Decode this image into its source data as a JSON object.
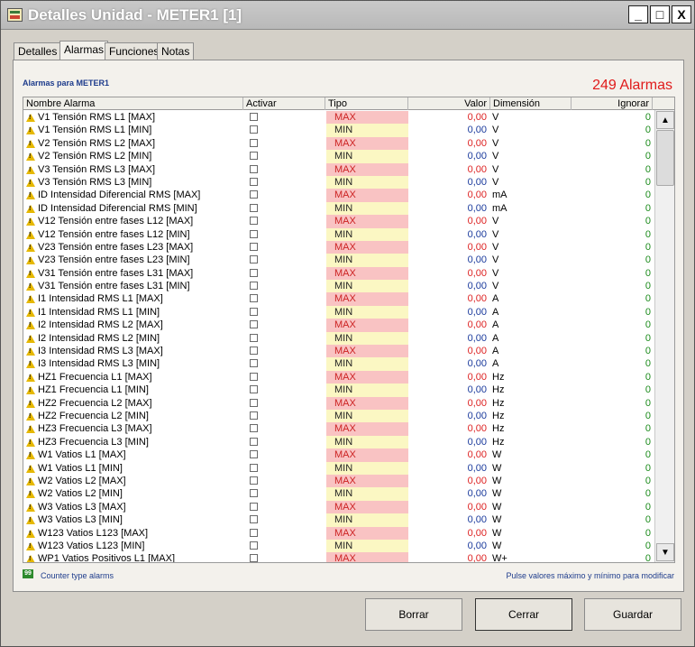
{
  "window": {
    "title": "Detalles Unidad - METER1 [1]",
    "buttons": {
      "minimize": "_",
      "maximize": "□",
      "close": "X"
    }
  },
  "tabs": [
    {
      "label": "Detalles",
      "active": false
    },
    {
      "label": "Alarmas",
      "active": true
    },
    {
      "label": "Funciones",
      "active": false
    },
    {
      "label": "Notas",
      "active": false
    }
  ],
  "panel": {
    "title": "Alarmas para METER1",
    "count": "249 Alarmas",
    "footer_badge": "99",
    "footer_left": "Counter type alarms",
    "footer_right": "Pulse valores máximo y mínimo para modificar"
  },
  "columns": {
    "name": "Nombre Alarma",
    "activar": "Activar",
    "tipo": "Tipo",
    "valor": "Valor",
    "dimension": "Dimensión",
    "ignorar": "Ignorar"
  },
  "rows": [
    {
      "name": "V1 Tensión RMS L1 [MAX]",
      "tipo": "MAX",
      "valor": "0,00",
      "dim": "V",
      "ign": "0"
    },
    {
      "name": "V1 Tensión RMS L1 [MIN]",
      "tipo": "MIN",
      "valor": "0,00",
      "dim": "V",
      "ign": "0"
    },
    {
      "name": "V2 Tensión RMS L2 [MAX]",
      "tipo": "MAX",
      "valor": "0,00",
      "dim": "V",
      "ign": "0"
    },
    {
      "name": "V2 Tensión RMS L2 [MIN]",
      "tipo": "MIN",
      "valor": "0,00",
      "dim": "V",
      "ign": "0"
    },
    {
      "name": "V3 Tensión RMS L3 [MAX]",
      "tipo": "MAX",
      "valor": "0,00",
      "dim": "V",
      "ign": "0"
    },
    {
      "name": "V3 Tensión RMS L3 [MIN]",
      "tipo": "MIN",
      "valor": "0,00",
      "dim": "V",
      "ign": "0"
    },
    {
      "name": "ID Intensidad Diferencial RMS [MAX]",
      "tipo": "MAX",
      "valor": "0,00",
      "dim": "mA",
      "ign": "0"
    },
    {
      "name": "ID Intensidad Diferencial RMS [MIN]",
      "tipo": "MIN",
      "valor": "0,00",
      "dim": "mA",
      "ign": "0"
    },
    {
      "name": "V12 Tensión entre fases L12 [MAX]",
      "tipo": "MAX",
      "valor": "0,00",
      "dim": "V",
      "ign": "0"
    },
    {
      "name": "V12 Tensión entre fases L12 [MIN]",
      "tipo": "MIN",
      "valor": "0,00",
      "dim": "V",
      "ign": "0"
    },
    {
      "name": "V23 Tensión entre fases L23 [MAX]",
      "tipo": "MAX",
      "valor": "0,00",
      "dim": "V",
      "ign": "0"
    },
    {
      "name": "V23 Tensión entre fases L23 [MIN]",
      "tipo": "MIN",
      "valor": "0,00",
      "dim": "V",
      "ign": "0"
    },
    {
      "name": "V31 Tensión entre fases L31 [MAX]",
      "tipo": "MAX",
      "valor": "0,00",
      "dim": "V",
      "ign": "0"
    },
    {
      "name": "V31 Tensión entre fases L31 [MIN]",
      "tipo": "MIN",
      "valor": "0,00",
      "dim": "V",
      "ign": "0"
    },
    {
      "name": "I1 Intensidad RMS L1 [MAX]",
      "tipo": "MAX",
      "valor": "0,00",
      "dim": "A",
      "ign": "0"
    },
    {
      "name": "I1 Intensidad RMS L1 [MIN]",
      "tipo": "MIN",
      "valor": "0,00",
      "dim": "A",
      "ign": "0"
    },
    {
      "name": "I2 Intensidad RMS L2 [MAX]",
      "tipo": "MAX",
      "valor": "0,00",
      "dim": "A",
      "ign": "0"
    },
    {
      "name": "I2 Intensidad RMS L2 [MIN]",
      "tipo": "MIN",
      "valor": "0,00",
      "dim": "A",
      "ign": "0"
    },
    {
      "name": "I3 Intensidad RMS L3 [MAX]",
      "tipo": "MAX",
      "valor": "0,00",
      "dim": "A",
      "ign": "0"
    },
    {
      "name": "I3 Intensidad RMS L3 [MIN]",
      "tipo": "MIN",
      "valor": "0,00",
      "dim": "A",
      "ign": "0"
    },
    {
      "name": "HZ1 Frecuencia L1 [MAX]",
      "tipo": "MAX",
      "valor": "0,00",
      "dim": "Hz",
      "ign": "0"
    },
    {
      "name": "HZ1 Frecuencia L1 [MIN]",
      "tipo": "MIN",
      "valor": "0,00",
      "dim": "Hz",
      "ign": "0"
    },
    {
      "name": "HZ2 Frecuencia L2 [MAX]",
      "tipo": "MAX",
      "valor": "0,00",
      "dim": "Hz",
      "ign": "0"
    },
    {
      "name": "HZ2 Frecuencia L2 [MIN]",
      "tipo": "MIN",
      "valor": "0,00",
      "dim": "Hz",
      "ign": "0"
    },
    {
      "name": "HZ3 Frecuencia L3 [MAX]",
      "tipo": "MAX",
      "valor": "0,00",
      "dim": "Hz",
      "ign": "0"
    },
    {
      "name": "HZ3 Frecuencia L3 [MIN]",
      "tipo": "MIN",
      "valor": "0,00",
      "dim": "Hz",
      "ign": "0"
    },
    {
      "name": "W1 Vatios L1 [MAX]",
      "tipo": "MAX",
      "valor": "0,00",
      "dim": "W",
      "ign": "0"
    },
    {
      "name": "W1 Vatios L1 [MIN]",
      "tipo": "MIN",
      "valor": "0,00",
      "dim": "W",
      "ign": "0"
    },
    {
      "name": "W2 Vatios L2 [MAX]",
      "tipo": "MAX",
      "valor": "0,00",
      "dim": "W",
      "ign": "0"
    },
    {
      "name": "W2 Vatios L2 [MIN]",
      "tipo": "MIN",
      "valor": "0,00",
      "dim": "W",
      "ign": "0"
    },
    {
      "name": "W3 Vatios L3 [MAX]",
      "tipo": "MAX",
      "valor": "0,00",
      "dim": "W",
      "ign": "0"
    },
    {
      "name": "W3 Vatios L3 [MIN]",
      "tipo": "MIN",
      "valor": "0,00",
      "dim": "W",
      "ign": "0"
    },
    {
      "name": "W123 Vatios L123 [MAX]",
      "tipo": "MAX",
      "valor": "0,00",
      "dim": "W",
      "ign": "0"
    },
    {
      "name": "W123 Vatios L123 [MIN]",
      "tipo": "MIN",
      "valor": "0,00",
      "dim": "W",
      "ign": "0"
    },
    {
      "name": "WP1 Vatios Positivos L1 [MAX]",
      "tipo": "MAX",
      "valor": "0,00",
      "dim": "W+",
      "ign": "0"
    }
  ],
  "scroll": {
    "up": "▲",
    "down": "▼"
  },
  "buttons": {
    "borrar": "Borrar",
    "cerrar": "Cerrar",
    "guardar": "Guardar"
  },
  "colors": {
    "max_bg": "#f9c3c3",
    "min_bg": "#fbf7c3",
    "count": "#e01b1b"
  }
}
